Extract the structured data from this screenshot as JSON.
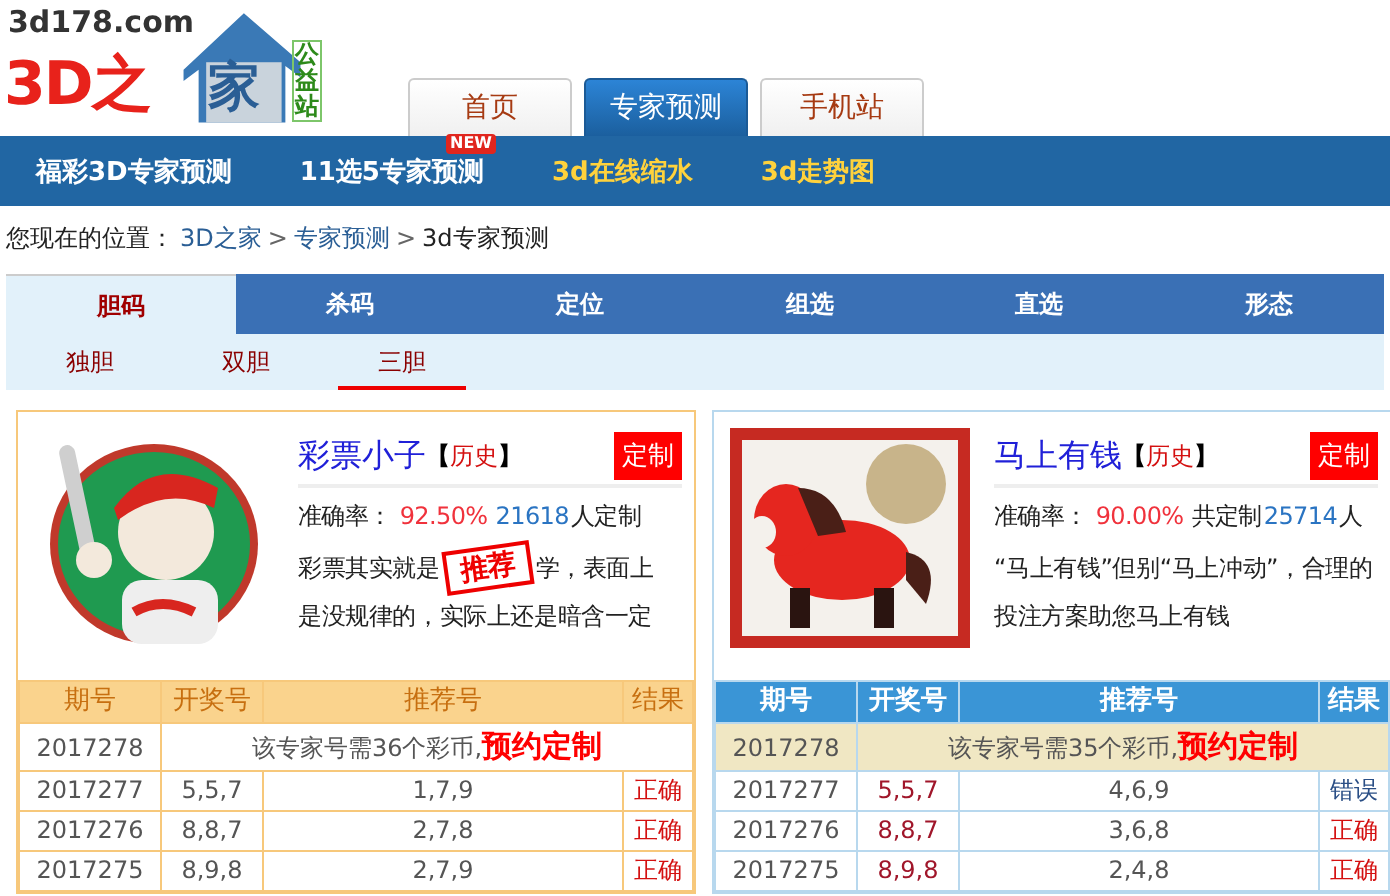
{
  "logo": {
    "domain": "3d178.com",
    "name_a": "3D之",
    "name_b": "家",
    "badge": "公益站"
  },
  "top_tabs": [
    {
      "label": "首页",
      "selected": false
    },
    {
      "label": "专家预测",
      "selected": true
    },
    {
      "label": "手机站",
      "selected": false
    }
  ],
  "nav": [
    {
      "label": "福彩3D专家预测",
      "color": "#ffffff"
    },
    {
      "label": "11选5专家预测",
      "color": "#ffffff",
      "badge": "NEW"
    },
    {
      "label": "3d在线缩水",
      "color": "#ffd23c"
    },
    {
      "label": "3d走势图",
      "color": "#ffd23c"
    }
  ],
  "breadcrumb": {
    "prefix": "您现在的位置：",
    "links": [
      "3D之家",
      "专家预测"
    ],
    "current": "3d专家预测",
    "separator": ">"
  },
  "category_tabs": [
    {
      "label": "胆码",
      "selected": true
    },
    {
      "label": "杀码",
      "selected": false
    },
    {
      "label": "定位",
      "selected": false
    },
    {
      "label": "组选",
      "selected": false
    },
    {
      "label": "直选",
      "selected": false
    },
    {
      "label": "形态",
      "selected": false
    }
  ],
  "sub_tabs": [
    {
      "label": "独胆",
      "selected": false
    },
    {
      "label": "双胆",
      "selected": false
    },
    {
      "label": "三胆",
      "selected": true
    }
  ],
  "experts": [
    {
      "kind": "orange",
      "name": "彩票小子",
      "history": "历史",
      "history_open": "【",
      "history_close": "】",
      "subscribe": "定制",
      "stats": [
        {
          "kind": "label",
          "text": "准确率："
        },
        {
          "kind": "rate",
          "text": "92.50%"
        },
        {
          "kind": "count",
          "text": "21618"
        },
        {
          "kind": "label",
          "text": "人定制"
        }
      ],
      "description_lines": [
        [
          {
            "kind": "text",
            "text": "彩票其实就是"
          },
          {
            "kind": "stamp",
            "text": "推荐"
          },
          {
            "kind": "text",
            "text": "学，表面上"
          }
        ],
        [
          {
            "kind": "text",
            "text": "是没规律的，实际上还是暗含一定"
          }
        ]
      ],
      "columns": [
        "期号",
        "开奖号",
        "推荐号",
        "结果"
      ],
      "notice": {
        "period": "2017278",
        "text": "该专家号需36个彩币,",
        "link": "预约定制"
      },
      "rows": [
        {
          "period": "2017277",
          "draw": "5,5,7",
          "pick": "1,7,9",
          "result": "正确",
          "correct": true
        },
        {
          "period": "2017276",
          "draw": "8,8,7",
          "pick": "2,7,8",
          "result": "正确",
          "correct": true
        },
        {
          "period": "2017275",
          "draw": "8,9,8",
          "pick": "2,7,9",
          "result": "正确",
          "correct": true
        }
      ]
    },
    {
      "kind": "blue",
      "name": "马上有钱",
      "history": "历史",
      "history_open": "【",
      "history_close": "】",
      "subscribe": "定制",
      "stats": [
        {
          "kind": "label",
          "text": "准确率："
        },
        {
          "kind": "rate",
          "text": "90.00%"
        },
        {
          "kind": "label",
          "text": "共定制"
        },
        {
          "kind": "count",
          "text": "25714"
        },
        {
          "kind": "label",
          "text": "人"
        }
      ],
      "description_lines": [
        [
          {
            "kind": "text",
            "text": "“马上有钱”但别“马上冲动”，合理的"
          }
        ],
        [
          {
            "kind": "text",
            "text": "投注方案助您马上有钱"
          }
        ]
      ],
      "columns": [
        "期号",
        "开奖号",
        "推荐号",
        "结果"
      ],
      "notice": {
        "period": "2017278",
        "text": "该专家号需35个彩币,",
        "link": "预约定制"
      },
      "rows": [
        {
          "period": "2017277",
          "draw": "5,5,7",
          "pick": "4,6,9",
          "result": "错误",
          "correct": false
        },
        {
          "period": "2017276",
          "draw": "8,8,7",
          "pick": "3,6,8",
          "result": "正确",
          "correct": true
        },
        {
          "period": "2017275",
          "draw": "8,9,8",
          "pick": "2,4,8",
          "result": "正确",
          "correct": true
        }
      ]
    }
  ]
}
